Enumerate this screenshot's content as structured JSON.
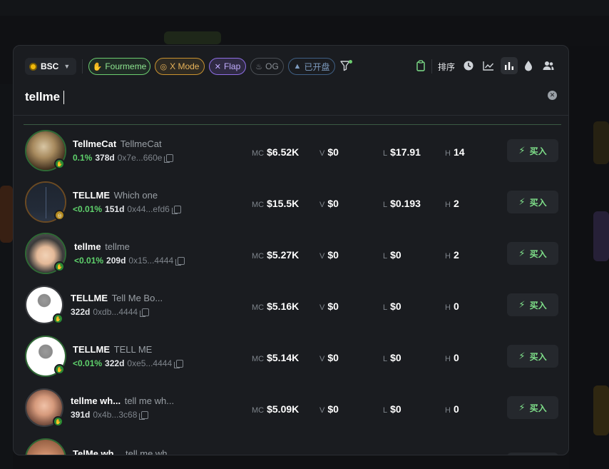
{
  "toolbar": {
    "chain": "BSC",
    "chips": {
      "fourmeme": "Fourmeme",
      "xmode": "X Mode",
      "flap": "Flap",
      "og": "OG",
      "opened": "已开盘"
    },
    "sort_label": "排序"
  },
  "search": {
    "value": "tellme"
  },
  "rows": [
    {
      "symbol": "TellmeCat",
      "name": "TellmeCat",
      "pct": "0.1%",
      "age": "378d",
      "address": "0x7e...660e",
      "mc": "$6.52K",
      "v": "$0",
      "l": "$17.91",
      "h": "14",
      "buy": "买入"
    },
    {
      "symbol": "TELLME",
      "name": "Which one",
      "pct": "<0.01%",
      "age": "151d",
      "address": "0x44...efd6",
      "mc": "$15.5K",
      "v": "$0",
      "l": "$0.193",
      "h": "2",
      "buy": "买入"
    },
    {
      "symbol": "tellme",
      "name": "tellme",
      "pct": "<0.01%",
      "age": "209d",
      "address": "0x15...4444",
      "mc": "$5.27K",
      "v": "$0",
      "l": "$0",
      "h": "2",
      "buy": "买入"
    },
    {
      "symbol": "TELLME",
      "name": "Tell Me Bo...",
      "pct": "",
      "age": "322d",
      "address": "0xdb...4444",
      "mc": "$5.16K",
      "v": "$0",
      "l": "$0",
      "h": "0",
      "buy": "买入"
    },
    {
      "symbol": "TELLME",
      "name": "TELL ME",
      "pct": "<0.01%",
      "age": "322d",
      "address": "0xe5...4444",
      "mc": "$5.14K",
      "v": "$0",
      "l": "$0",
      "h": "0",
      "buy": "买入"
    },
    {
      "symbol": "tellme wh...",
      "name": "tell me wh...",
      "pct": "",
      "age": "391d",
      "address": "0x4b...3c68",
      "mc": "$5.09K",
      "v": "$0",
      "l": "$0",
      "h": "0",
      "buy": "买入"
    },
    {
      "symbol": "TelMe wh...",
      "name": "tell me wh...",
      "pct": "",
      "age": "",
      "address": "",
      "mc": "",
      "v": "",
      "l": "",
      "h": "",
      "buy": ""
    }
  ],
  "labels": {
    "mc": "MC",
    "v": "V",
    "l": "L",
    "h": "H"
  },
  "colors": {
    "accent_green": "#5fd26c",
    "fourmeme": "#6ccd6f",
    "xmode": "#c9922f",
    "flap": "#8f6fe6",
    "panel": "#1a1c20"
  }
}
